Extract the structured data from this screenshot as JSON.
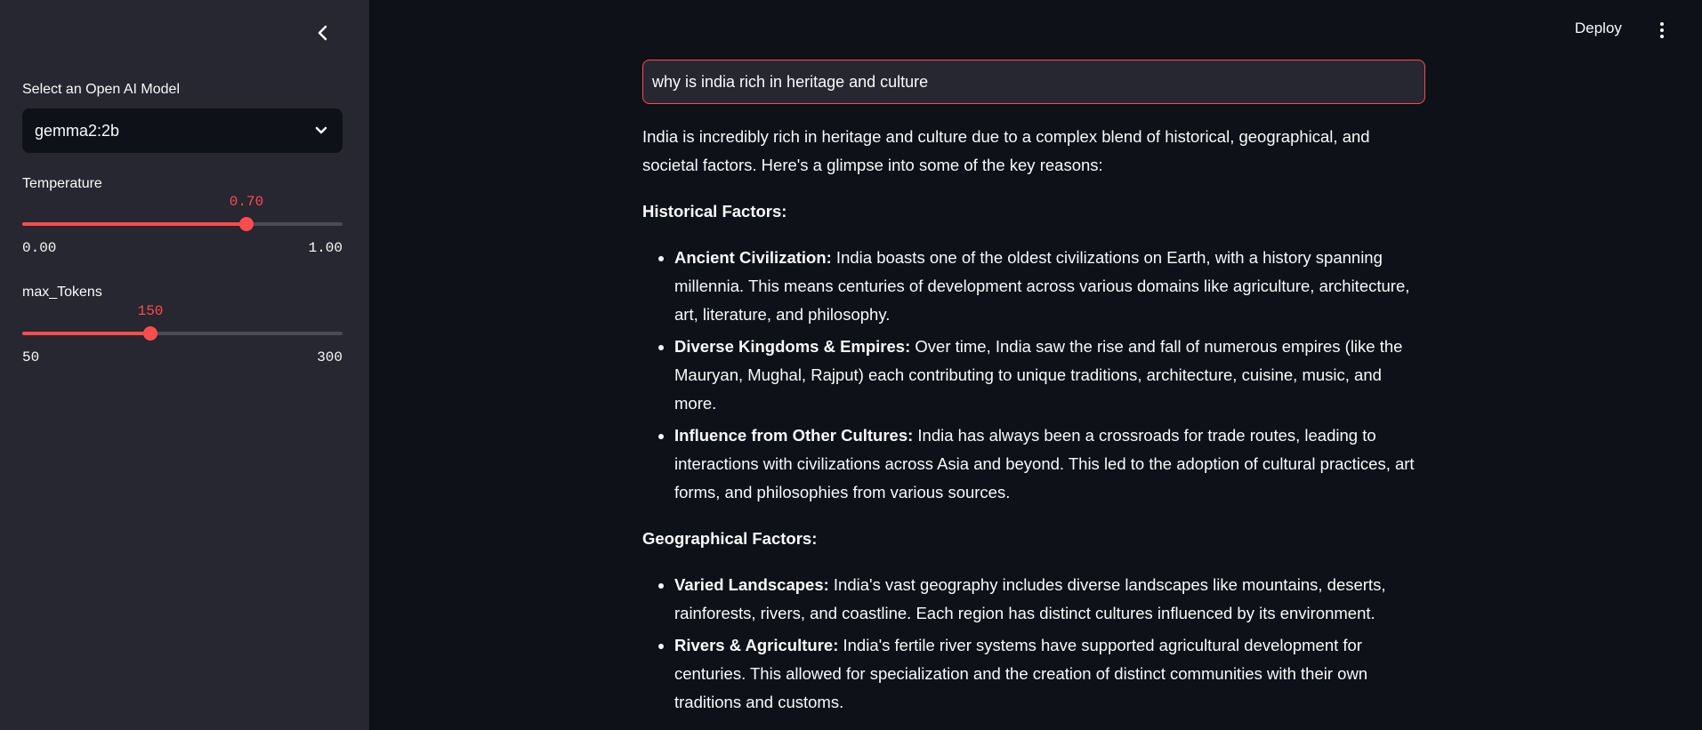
{
  "sidebar": {
    "model_label": "Select an Open AI Model",
    "model_value": "gemma2:2b",
    "temperature": {
      "label": "Temperature",
      "value_text": "0.70",
      "min_text": "0.00",
      "max_text": "1.00",
      "value": 0.7,
      "min": 0,
      "max": 1
    },
    "max_tokens": {
      "label": "max_Tokens",
      "value_text": "150",
      "min_text": "50",
      "max_text": "300",
      "value": 150,
      "min": 50,
      "max": 300
    }
  },
  "header": {
    "deploy_label": "Deploy"
  },
  "chat": {
    "input_value": "why is india rich in heritage and culture"
  },
  "response": {
    "intro": "India is incredibly rich in heritage and culture due to a complex blend of historical, geographical, and societal factors. Here's a glimpse into some of the key reasons:",
    "sections": [
      {
        "heading": "Historical Factors:",
        "items": [
          {
            "title": "Ancient Civilization:",
            "text": " India boasts one of the oldest civilizations on Earth, with a history spanning millennia. This means centuries of development across various domains like agriculture, architecture, art, literature, and philosophy."
          },
          {
            "title": "Diverse Kingdoms & Empires:",
            "text": " Over time, India saw the rise and fall of numerous empires (like the Mauryan, Mughal, Rajput) each contributing to unique traditions, architecture, cuisine, music, and more."
          },
          {
            "title": "Influence from Other Cultures:",
            "text": " India has always been a crossroads for trade routes, leading to interactions with civilizations across Asia and beyond. This led to the adoption of cultural practices, art forms, and philosophies from various sources."
          }
        ]
      },
      {
        "heading": "Geographical Factors:",
        "items": [
          {
            "title": "Varied Landscapes:",
            "text": " India's vast geography includes diverse landscapes like mountains, deserts, rainforests, rivers, and coastline. Each region has distinct cultures influenced by its environment."
          },
          {
            "title": "Rivers & Agriculture:",
            "text": " India's fertile river systems have supported agricultural development for centuries. This allowed for specialization and the creation of distinct communities with their own traditions and customs."
          }
        ]
      }
    ]
  },
  "colors": {
    "accent": "#ff4b4b",
    "sidebar_bg": "#262730",
    "main_bg": "#0e1117"
  },
  "icons": {
    "collapse": "chevron-left-icon",
    "select": "chevron-down-icon",
    "menu": "kebab-menu-icon"
  }
}
